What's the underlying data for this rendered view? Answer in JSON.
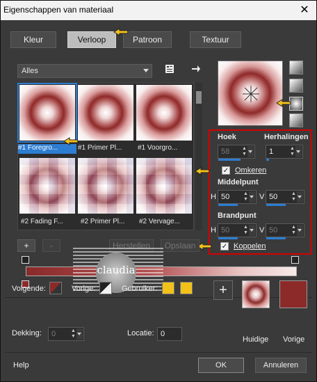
{
  "window": {
    "title": "Eigenschappen van materiaal",
    "close": "✕"
  },
  "tabs": [
    {
      "label": "Kleur"
    },
    {
      "label": "Verloop"
    },
    {
      "label": "Patroon"
    },
    {
      "label": "Textuur"
    }
  ],
  "gallery": {
    "filter": "Alles",
    "items": [
      {
        "label": "#1 Foregro..."
      },
      {
        "label": "#1 Primer Pl..."
      },
      {
        "label": "#1 Voorgro..."
      },
      {
        "label": "#2 Fading F..."
      },
      {
        "label": "#2 Primer Pl..."
      },
      {
        "label": "#2 Vervage..."
      }
    ]
  },
  "gradient_settings": {
    "angle_label": "Hoek",
    "angle_value": "58",
    "repeats_label": "Herhalingen",
    "repeats_value": "1",
    "invert_label": "Omkeren",
    "invert_checked": true,
    "center_label": "Middelpunt",
    "center_h": "50",
    "center_v": "50",
    "focal_label": "Brandpunt",
    "focal_h": "50",
    "focal_v": "50",
    "link_label": "Koppelen",
    "link_checked": true,
    "h_label": "H",
    "v_label": "V"
  },
  "editor": {
    "add": "+",
    "remove": "-",
    "reset": "Herstellen",
    "save": "Opslaan",
    "watermark": "claudia"
  },
  "footer": {
    "next_label": "Volgende:",
    "prev_label": "Vorige:",
    "user_label": "Gebruiker:",
    "opacity_label": "Dekking:",
    "opacity_value": "0",
    "location_label": "Locatie:",
    "location_value": "0",
    "current_label": "Huidige",
    "previous_label": "Vorige",
    "plus": "+"
  },
  "buttons": {
    "help": "Help",
    "ok": "OK",
    "cancel": "Annuleren"
  },
  "colors": {
    "dark_red": "#8c2a2a",
    "accent_blue": "#2d7dd2",
    "highlight_red": "#d60000",
    "user_yellow": "#f2c21b"
  }
}
